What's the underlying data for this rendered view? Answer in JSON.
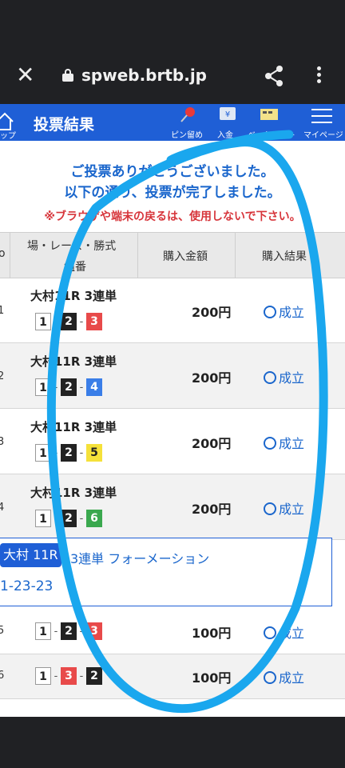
{
  "browser": {
    "url": "spweb.brtb.jp"
  },
  "header": {
    "title": "投票結果",
    "home_label": "ップ",
    "items": [
      {
        "label": "ピン留め",
        "icon": "pin-icon"
      },
      {
        "label": "入金",
        "icon": "deposit-icon"
      },
      {
        "label": "ベットリスト",
        "icon": "ticket-icon"
      },
      {
        "label": "マイページ",
        "icon": "menu-icon"
      }
    ]
  },
  "messages": {
    "thanks1": "ご投票ありがとうございました。",
    "thanks2": "以下の通り、投票が完了しました。",
    "warning": "※ブラウザや端末の戻るは、使用しないで下さい。"
  },
  "table": {
    "col_no": "o",
    "col_race": "場・レース・勝式",
    "col_combo": "組番",
    "col_amount": "購入金額",
    "col_result": "購入結果",
    "rows": [
      {
        "no": "1",
        "race": "大村11R 3連単",
        "combo": [
          "1",
          "2",
          "3"
        ],
        "amount": "200円",
        "result": "成立"
      },
      {
        "no": "2",
        "race": "大村11R 3連単",
        "combo": [
          "1",
          "2",
          "4"
        ],
        "amount": "200円",
        "result": "成立"
      },
      {
        "no": "3",
        "race": "大村11R 3連単",
        "combo": [
          "1",
          "2",
          "5"
        ],
        "amount": "200円",
        "result": "成立"
      },
      {
        "no": "4",
        "race": "大村11R 3連単",
        "combo": [
          "1",
          "2",
          "6"
        ],
        "amount": "200円",
        "result": "成立"
      }
    ],
    "formation": {
      "badge": "大村 11R",
      "type": "3連単 フォーメーション",
      "combo": "1-23-23"
    },
    "formation_rows": [
      {
        "no": "5",
        "combo": [
          "1",
          "2",
          "3"
        ],
        "amount": "100円",
        "result": "成立"
      },
      {
        "no": "6",
        "combo": [
          "1",
          "3",
          "2"
        ],
        "amount": "100円",
        "result": "成立"
      }
    ]
  },
  "colors": {
    "accent": "#1f5fd6",
    "overlay_stroke": "#1aa7ee",
    "warning": "#d7353b"
  }
}
